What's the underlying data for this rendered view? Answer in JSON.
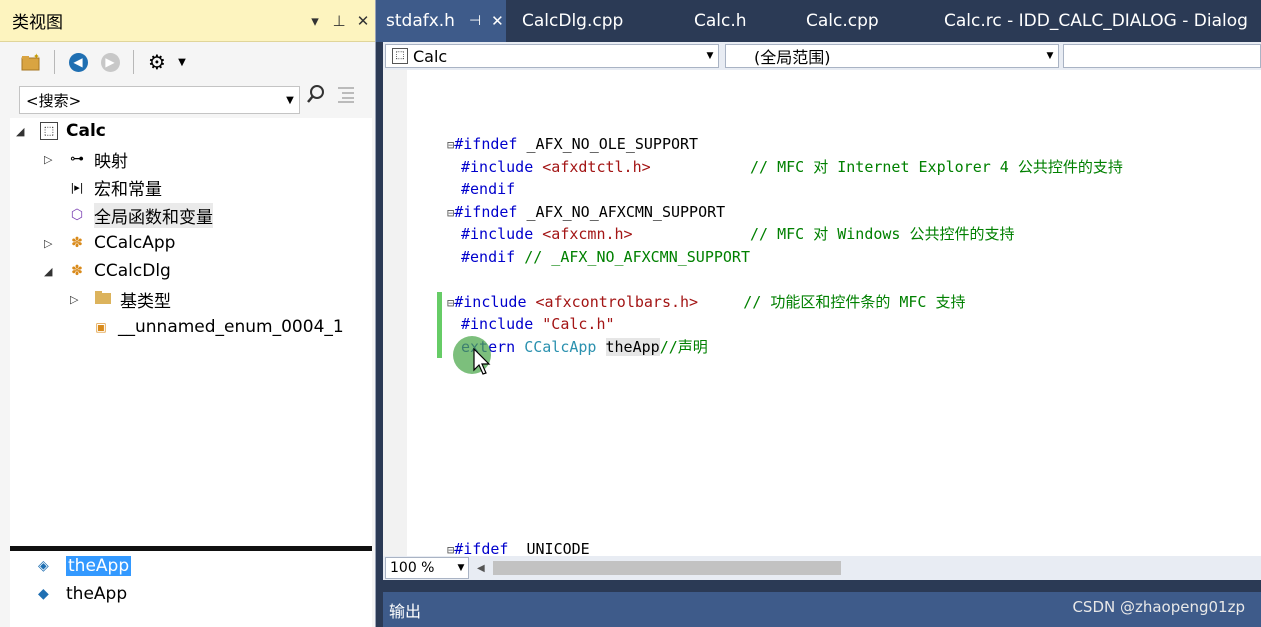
{
  "class_view": {
    "title": "类视图",
    "title_buttons": {
      "dropdown": "▾",
      "pin": "ᚘ",
      "close": "✕"
    },
    "search_placeholder": "<搜索>",
    "tree": {
      "root": "Calc",
      "map": "映射",
      "macros": "宏和常量",
      "globals": "全局函数和变量",
      "app_class": "CCalcApp",
      "dlg_class": "CCalcDlg",
      "base_types": "基类型",
      "enum": "__unnamed_enum_0004_1"
    },
    "members": [
      "theApp",
      "theApp"
    ]
  },
  "tabs": {
    "active": "stdafx.h",
    "others": [
      "CalcDlg.cpp",
      "Calc.h",
      "Calc.cpp",
      "Calc.rc - IDD_CALC_DIALOG - Dialog"
    ]
  },
  "navbar": {
    "project": "Calc",
    "scope": "(全局范围)"
  },
  "code": {
    "l1_kw": "#ifndef",
    "l1_rest": " _AFX_NO_OLE_SUPPORT",
    "l2_kw": "#include",
    "l2_str": "<afxdtctl.h>",
    "l2_cm": "// MFC 对 Internet Explorer 4 公共控件的支持",
    "l3_kw": "#endif",
    "l4_kw": "#ifndef",
    "l4_rest": " _AFX_NO_AFXCMN_SUPPORT",
    "l5_kw": "#include",
    "l5_str": "<afxcmn.h>",
    "l5_cm": "// MFC 对 Windows 公共控件的支持",
    "l6_kw": "#endif",
    "l6_cm": " // _AFX_NO_AFXCMN_SUPPORT",
    "l7_kw": "#include",
    "l7_str": "<afxcontrolbars.h>",
    "l7_cm": "// 功能区和控件条的 MFC 支持",
    "l8_kw": "#include",
    "l8_str": "\"Calc.h\"",
    "l9_kw": "extern",
    "l9_type": "CCalcApp",
    "l9_var": "theApp",
    "l9_cm": "//声明",
    "l10_kw": "#ifdef",
    "l10_rest": "  UNICODE"
  },
  "zoom": "100 %",
  "output_label": "输出",
  "watermark": "CSDN @zhaopeng01zp",
  "colors": {
    "accent": "#3399ff",
    "title_bar": "#fdf4bf",
    "tab_bg": "#2b3a55",
    "change_bar": "#66cc66"
  }
}
